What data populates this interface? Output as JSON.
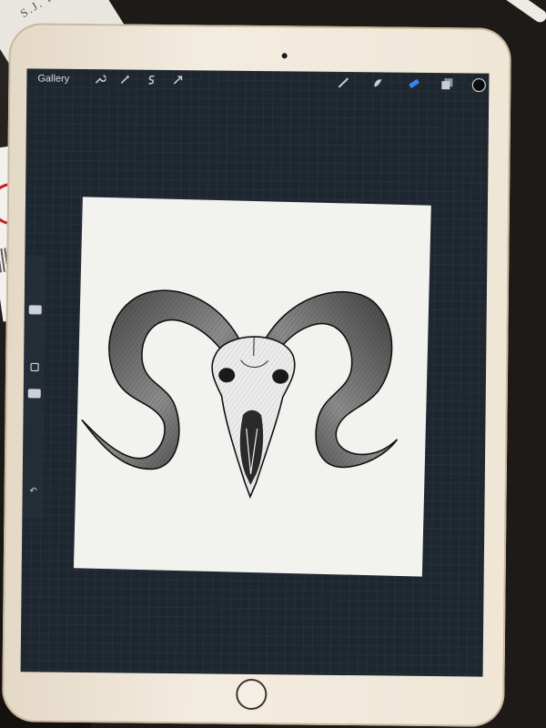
{
  "toolbar": {
    "gallery_label": "Gallery",
    "left_tools": [
      "wrench-icon",
      "magic-wand-icon",
      "selection-icon",
      "transform-icon"
    ],
    "right_tools": [
      "brush-icon",
      "smudge-icon",
      "eraser-icon",
      "layers-icon",
      "color-icon"
    ]
  },
  "background": {
    "book_text": "S.J. KINCAID"
  },
  "sidebar": {
    "items": [
      "brush-size-slider",
      "modify-button",
      "opacity-slider",
      "undo-icon"
    ]
  },
  "colors": {
    "accent": "#3b82f6",
    "screen_bg": "#1e2730",
    "canvas_bg": "#f2f2ef"
  }
}
